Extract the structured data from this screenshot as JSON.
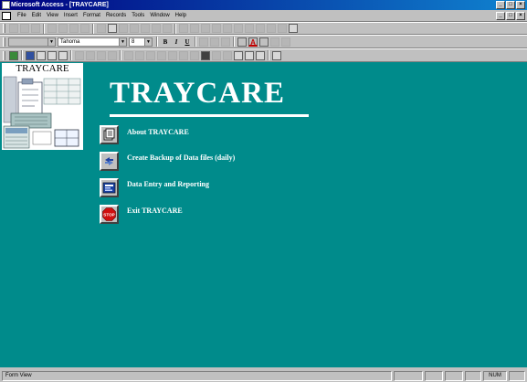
{
  "window": {
    "title": "Microsoft Access - [TRAYCARE]",
    "controls": [
      "_",
      "□",
      "×"
    ],
    "mdi_controls": [
      "_",
      "□",
      "×"
    ]
  },
  "menubar": {
    "items": [
      "File",
      "Edit",
      "View",
      "Insert",
      "Format",
      "Records",
      "Tools",
      "Window",
      "Help"
    ]
  },
  "formatting": {
    "font_name": "Tahoma",
    "font_size": "8",
    "bold": "B",
    "italic": "I",
    "underline": "U"
  },
  "form": {
    "logo_text": "TRAYCARE",
    "title": "TRAYCARE",
    "menu_items": [
      {
        "label": "About TRAYCARE",
        "icon": "about-icon"
      },
      {
        "label": "Create Backup of Data files (daily)",
        "icon": "backup-icon"
      },
      {
        "label": "Data Entry and Reporting",
        "icon": "data-entry-icon"
      },
      {
        "label": "Exit TRAYCARE",
        "icon": "stop-icon"
      }
    ],
    "colors": {
      "background": "#008b8b",
      "text": "#ffffff"
    }
  },
  "statusbar": {
    "text": "Form View",
    "num": "NUM"
  }
}
